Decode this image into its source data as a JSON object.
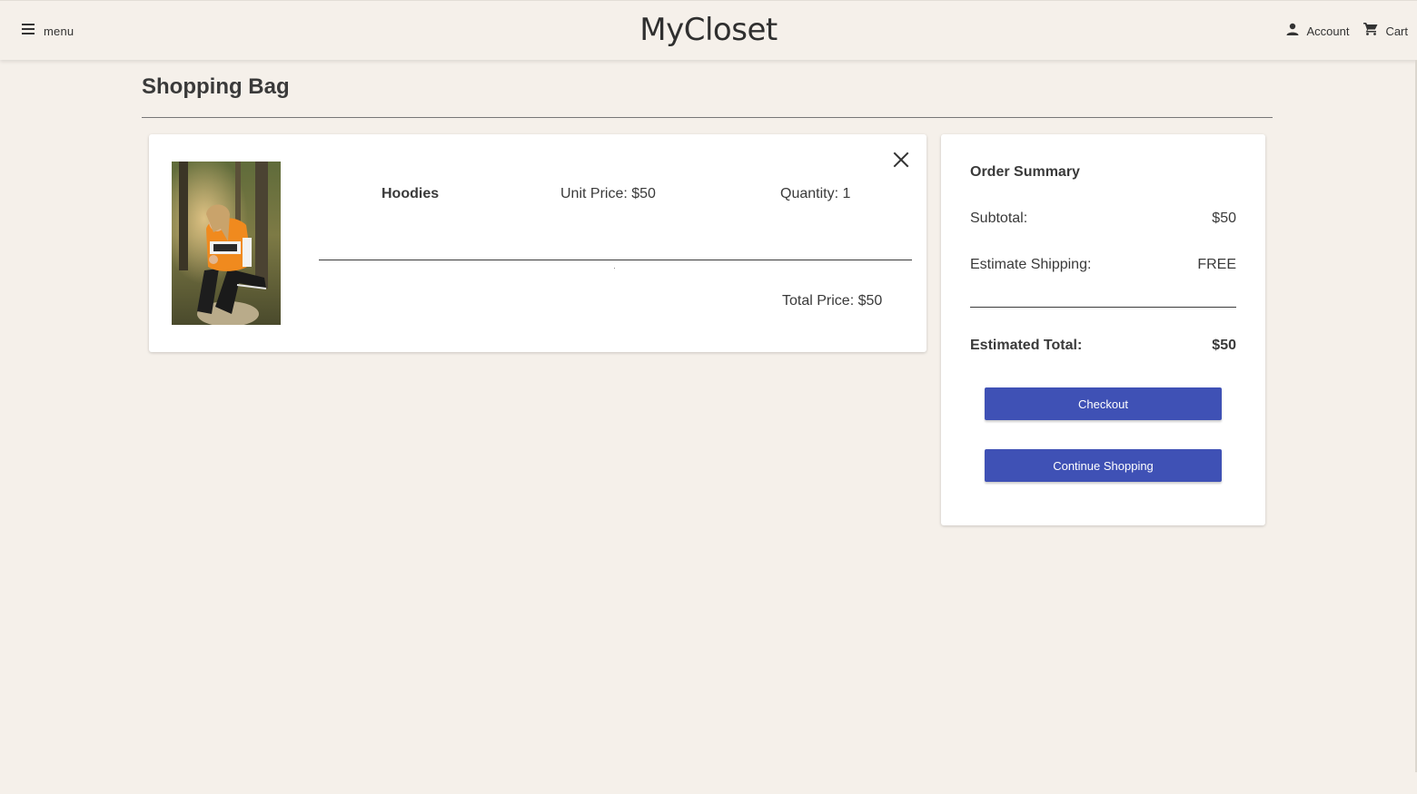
{
  "header": {
    "menu_label": "menu",
    "brand": "MyCloset",
    "account_label": "Account",
    "cart_label": "Cart"
  },
  "page": {
    "title": "Shopping Bag"
  },
  "cart_items": [
    {
      "name": "Hoodies",
      "unit_price": "Unit Price: $50",
      "quantity": "Quantity: 1",
      "total_price": "Total Price: $50",
      "image": "person-in-orange-hoodie-photo"
    }
  ],
  "summary": {
    "title": "Order Summary",
    "subtotal_label": "Subtotal:",
    "subtotal_value": "$50",
    "shipping_label": "Estimate Shipping:",
    "shipping_value": "FREE",
    "total_label": "Estimated Total:",
    "total_value": "$50",
    "checkout_label": "Checkout",
    "continue_label": "Continue Shopping"
  },
  "icons": {
    "menu": "hamburger-icon",
    "account": "person-icon",
    "cart": "shopping-cart-icon",
    "remove": "close-icon"
  },
  "colors": {
    "background": "#f5f0ea",
    "primary_button": "#3f51b5",
    "text": "#3a3a3a"
  }
}
